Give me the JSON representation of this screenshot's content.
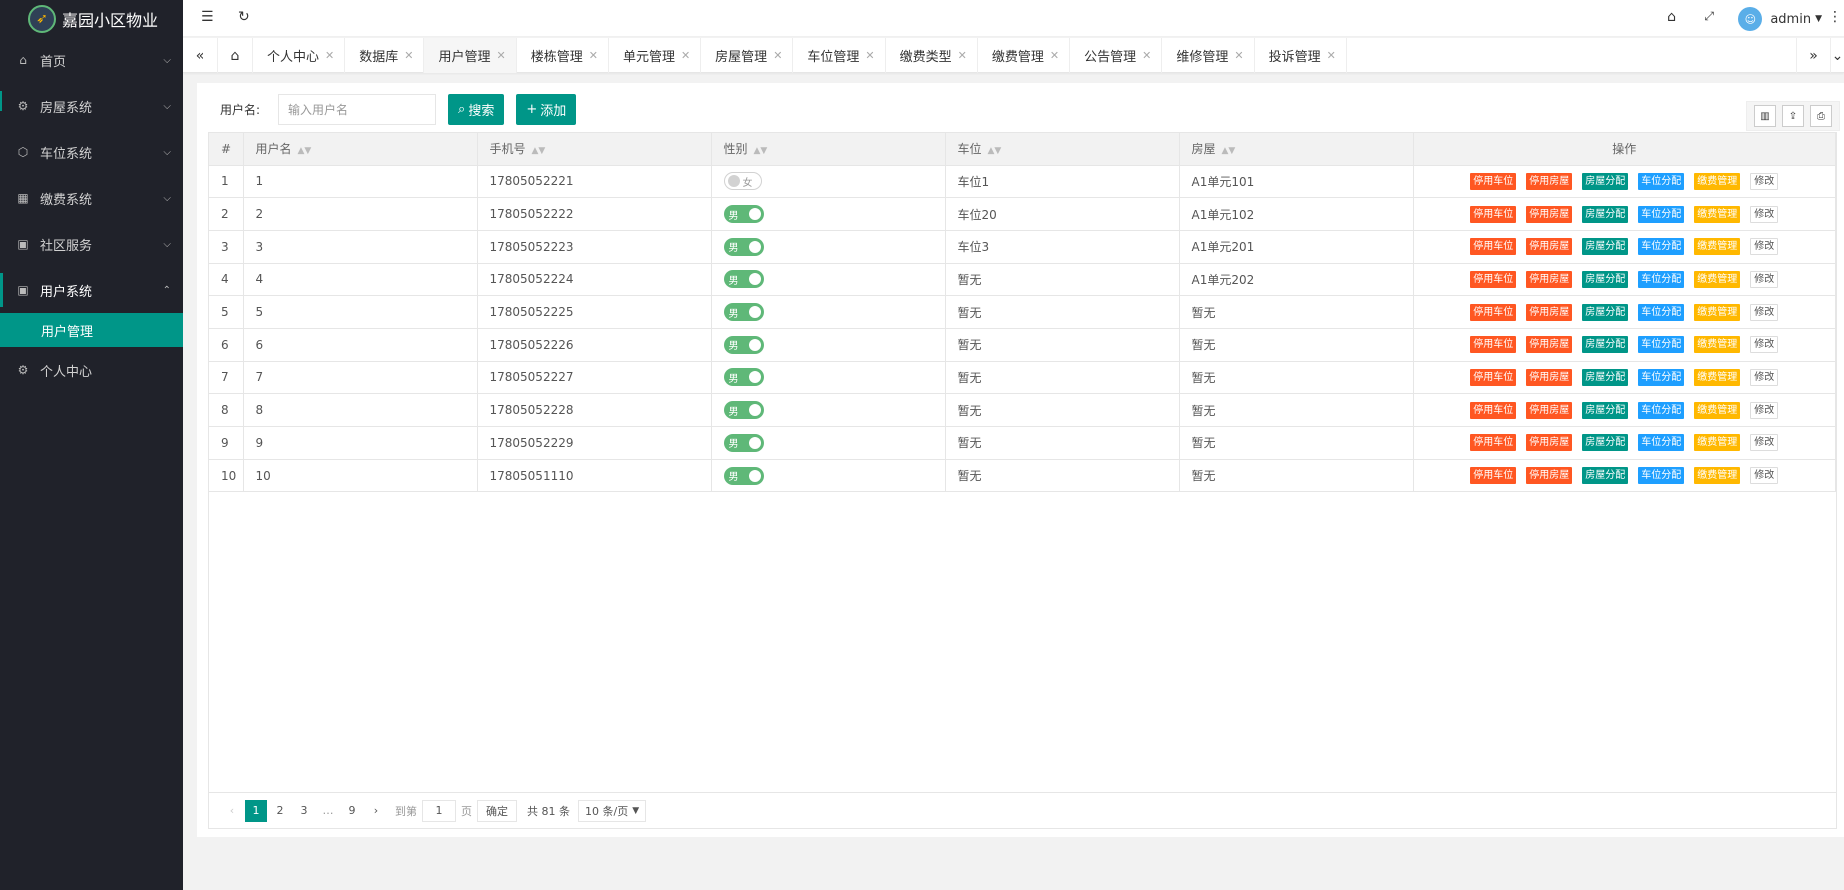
{
  "app": {
    "title": "嘉园小区物业"
  },
  "sidebar": {
    "items": [
      {
        "label": "首页",
        "icon": "home-icon"
      },
      {
        "label": "房屋系统",
        "icon": "gear-icon"
      },
      {
        "label": "车位系统",
        "icon": "cube-icon"
      },
      {
        "label": "缴费系统",
        "icon": "grid-icon"
      },
      {
        "label": "社区服务",
        "icon": "app-icon"
      },
      {
        "label": "用户系统",
        "icon": "app-icon"
      },
      {
        "label": "个人中心",
        "icon": "gear-icon"
      }
    ],
    "sub_active": "用户管理"
  },
  "header": {
    "user": "admin"
  },
  "tabs": [
    "个人中心",
    "数据库",
    "用户管理",
    "楼栋管理",
    "单元管理",
    "房屋管理",
    "车位管理",
    "缴费类型",
    "缴费管理",
    "公告管理",
    "维修管理",
    "投诉管理"
  ],
  "search": {
    "label": "用户名:",
    "placeholder": "输入用户名",
    "search_btn": "搜索",
    "add_btn": "添加"
  },
  "table": {
    "headers": [
      "#",
      "用户名",
      "手机号",
      "性别",
      "车位",
      "房屋",
      "操作"
    ],
    "rows": [
      {
        "n": "1",
        "name": "1",
        "phone": "17805052221",
        "gender": "女",
        "gender_on": false,
        "car": "车位1",
        "house": "A1单元101"
      },
      {
        "n": "2",
        "name": "2",
        "phone": "17805052222",
        "gender": "男",
        "gender_on": true,
        "car": "车位20",
        "house": "A1单元102"
      },
      {
        "n": "3",
        "name": "3",
        "phone": "17805052223",
        "gender": "男",
        "gender_on": true,
        "car": "车位3",
        "house": "A1单元201"
      },
      {
        "n": "4",
        "name": "4",
        "phone": "17805052224",
        "gender": "男",
        "gender_on": true,
        "car": "暂无",
        "house": "A1单元202"
      },
      {
        "n": "5",
        "name": "5",
        "phone": "17805052225",
        "gender": "男",
        "gender_on": true,
        "car": "暂无",
        "house": "暂无"
      },
      {
        "n": "6",
        "name": "6",
        "phone": "17805052226",
        "gender": "男",
        "gender_on": true,
        "car": "暂无",
        "house": "暂无"
      },
      {
        "n": "7",
        "name": "7",
        "phone": "17805052227",
        "gender": "男",
        "gender_on": true,
        "car": "暂无",
        "house": "暂无"
      },
      {
        "n": "8",
        "name": "8",
        "phone": "17805052228",
        "gender": "男",
        "gender_on": true,
        "car": "暂无",
        "house": "暂无"
      },
      {
        "n": "9",
        "name": "9",
        "phone": "17805052229",
        "gender": "男",
        "gender_on": true,
        "car": "暂无",
        "house": "暂无"
      },
      {
        "n": "10",
        "name": "10",
        "phone": "17805051110",
        "gender": "男",
        "gender_on": true,
        "car": "暂无",
        "house": "暂无"
      }
    ],
    "actions": [
      {
        "label": "停用车位",
        "style": "red"
      },
      {
        "label": "停用房屋",
        "style": "red"
      },
      {
        "label": "房屋分配",
        "style": "green"
      },
      {
        "label": "车位分配",
        "style": "blue"
      },
      {
        "label": "缴费管理",
        "style": "yellow"
      },
      {
        "label": "修改",
        "style": "white"
      }
    ]
  },
  "pager": {
    "pages": [
      "1",
      "2",
      "3",
      "…",
      "9"
    ],
    "current": "1",
    "goto_label": "到第",
    "goto_value": "1",
    "page_unit": "页",
    "confirm": "确定",
    "total": "共 81 条",
    "per_page": "10 条/页"
  },
  "colors": {
    "primary": "#009688",
    "sidebar_bg": "#20222a",
    "danger": "#ff5722",
    "info": "#1e9fff",
    "warn": "#ffb800",
    "switch_on": "#5fb878"
  }
}
